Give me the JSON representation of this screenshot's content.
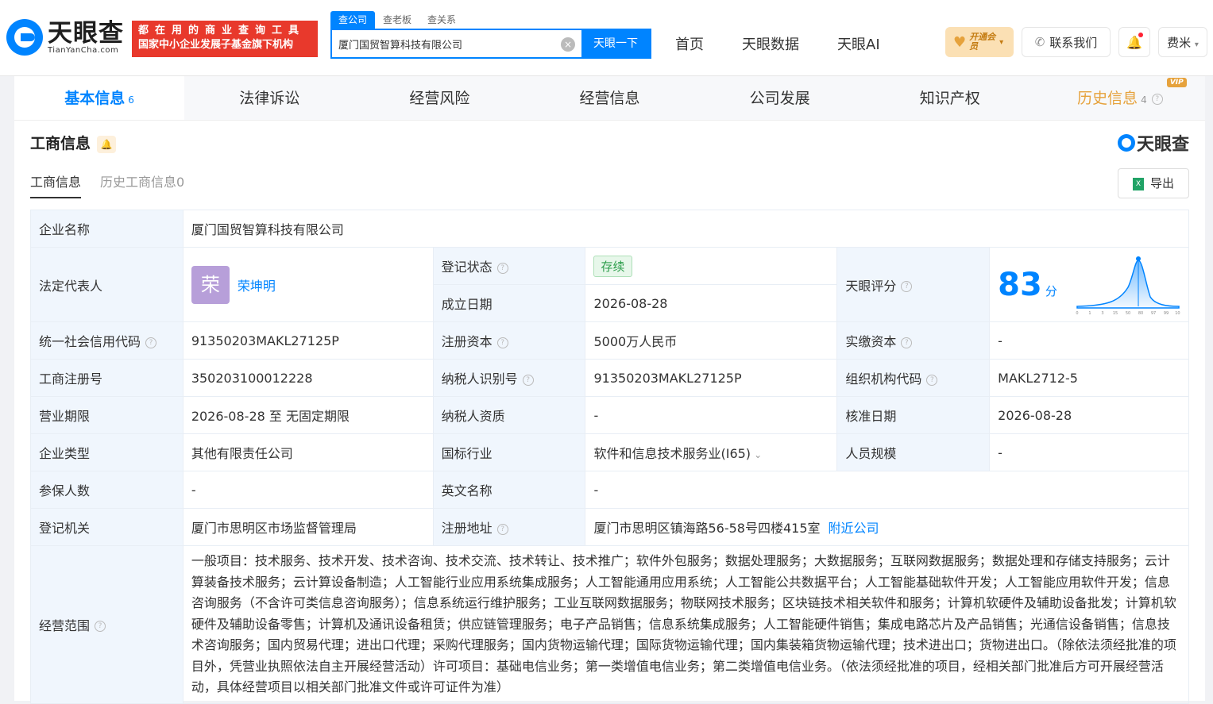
{
  "header": {
    "logo_cn": "天眼查",
    "logo_en": "TianYanCha.com",
    "slogan_line1": "都在用的商业查询工具",
    "slogan_line2": "国家中小企业发展子基金旗下机构",
    "search_tabs": [
      "查公司",
      "查老板",
      "查关系"
    ],
    "search_value": "厦门国贸智算科技有限公司",
    "search_button": "天眼一下",
    "nav": [
      "首页",
      "天眼数据",
      "天眼AI"
    ],
    "vip_label": "开通会员",
    "contact_label": "联系我们",
    "user_label": "费米"
  },
  "tabs": [
    {
      "label": "基本信息",
      "count": "6"
    },
    {
      "label": "法律诉讼"
    },
    {
      "label": "经营风险"
    },
    {
      "label": "经营信息"
    },
    {
      "label": "公司发展"
    },
    {
      "label": "知识产权"
    },
    {
      "label": "历史信息",
      "count": "4",
      "badge": "VIP"
    }
  ],
  "section": {
    "title": "工商信息",
    "brand": "天眼查",
    "subtabs": [
      "工商信息",
      "历史工商信息0"
    ],
    "export_label": "导出"
  },
  "info": {
    "company_name_label": "企业名称",
    "company_name": "厦门国贸智算科技有限公司",
    "legal_rep_label": "法定代表人",
    "legal_rep_avatar": "荣",
    "legal_rep": "荣坤明",
    "reg_status_label": "登记状态",
    "reg_status": "存续",
    "founded_label": "成立日期",
    "founded": "2026-08-28",
    "score_label": "天眼评分",
    "score": "83",
    "score_unit": "分",
    "credit_code_label": "统一社会信用代码",
    "credit_code": "91350203MAKL27125P",
    "reg_capital_label": "注册资本",
    "reg_capital": "5000万人民币",
    "paid_capital_label": "实缴资本",
    "paid_capital": "-",
    "reg_no_label": "工商注册号",
    "reg_no": "350203100012228",
    "taxpayer_id_label": "纳税人识别号",
    "taxpayer_id": "91350203MAKL27125P",
    "org_code_label": "组织机构代码",
    "org_code": "MAKL2712-5",
    "term_label": "营业期限",
    "term": "2026-08-28 至 无固定期限",
    "taxpayer_qual_label": "纳税人资质",
    "taxpayer_qual": "-",
    "approved_label": "核准日期",
    "approved": "2026-08-28",
    "type_label": "企业类型",
    "type": "其他有限责任公司",
    "industry_label": "国标行业",
    "industry": "软件和信息技术服务业(I65)",
    "staff_label": "人员规模",
    "staff": "-",
    "insured_label": "参保人数",
    "insured": "-",
    "en_name_label": "英文名称",
    "en_name": "-",
    "authority_label": "登记机关",
    "authority": "厦门市思明区市场监督管理局",
    "address_label": "注册地址",
    "address": "厦门市思明区镇海路56-58号四楼415室",
    "nearby_label": "附近公司",
    "scope_label": "经营范围",
    "scope": "一般项目：技术服务、技术开发、技术咨询、技术交流、技术转让、技术推广；软件外包服务；数据处理服务；大数据服务；互联网数据服务；数据处理和存储支持服务；云计算装备技术服务；云计算设备制造；人工智能行业应用系统集成服务；人工智能通用应用系统；人工智能公共数据平台；人工智能基础软件开发；人工智能应用软件开发；信息咨询服务（不含许可类信息咨询服务）；信息系统运行维护服务；工业互联网数据服务；物联网技术服务；区块链技术相关软件和服务；计算机软硬件及辅助设备批发；计算机软硬件及辅助设备零售；计算机及通讯设备租赁；供应链管理服务；电子产品销售；信息系统集成服务；人工智能硬件销售；集成电路芯片及产品销售；光通信设备销售；信息技术咨询服务；国内贸易代理；进出口代理；采购代理服务；国内货物运输代理；国际货物运输代理；国内集装箱货物运输代理；技术进出口；货物进出口。（除依法须经批准的项目外，凭营业执照依法自主开展经营活动）许可项目：基础电信业务；第一类增值电信业务；第二类增值电信业务。（依法须经批准的项目，经相关部门批准后方可开展经营活动，具体经营项目以相关部门批准文件或许可证件为准）"
  },
  "score_chart": {
    "ticks": [
      "0",
      "1",
      "3",
      "15",
      "50",
      "80",
      "97",
      "99",
      "100"
    ],
    "marker_value": "83",
    "color": "#0084ff"
  }
}
